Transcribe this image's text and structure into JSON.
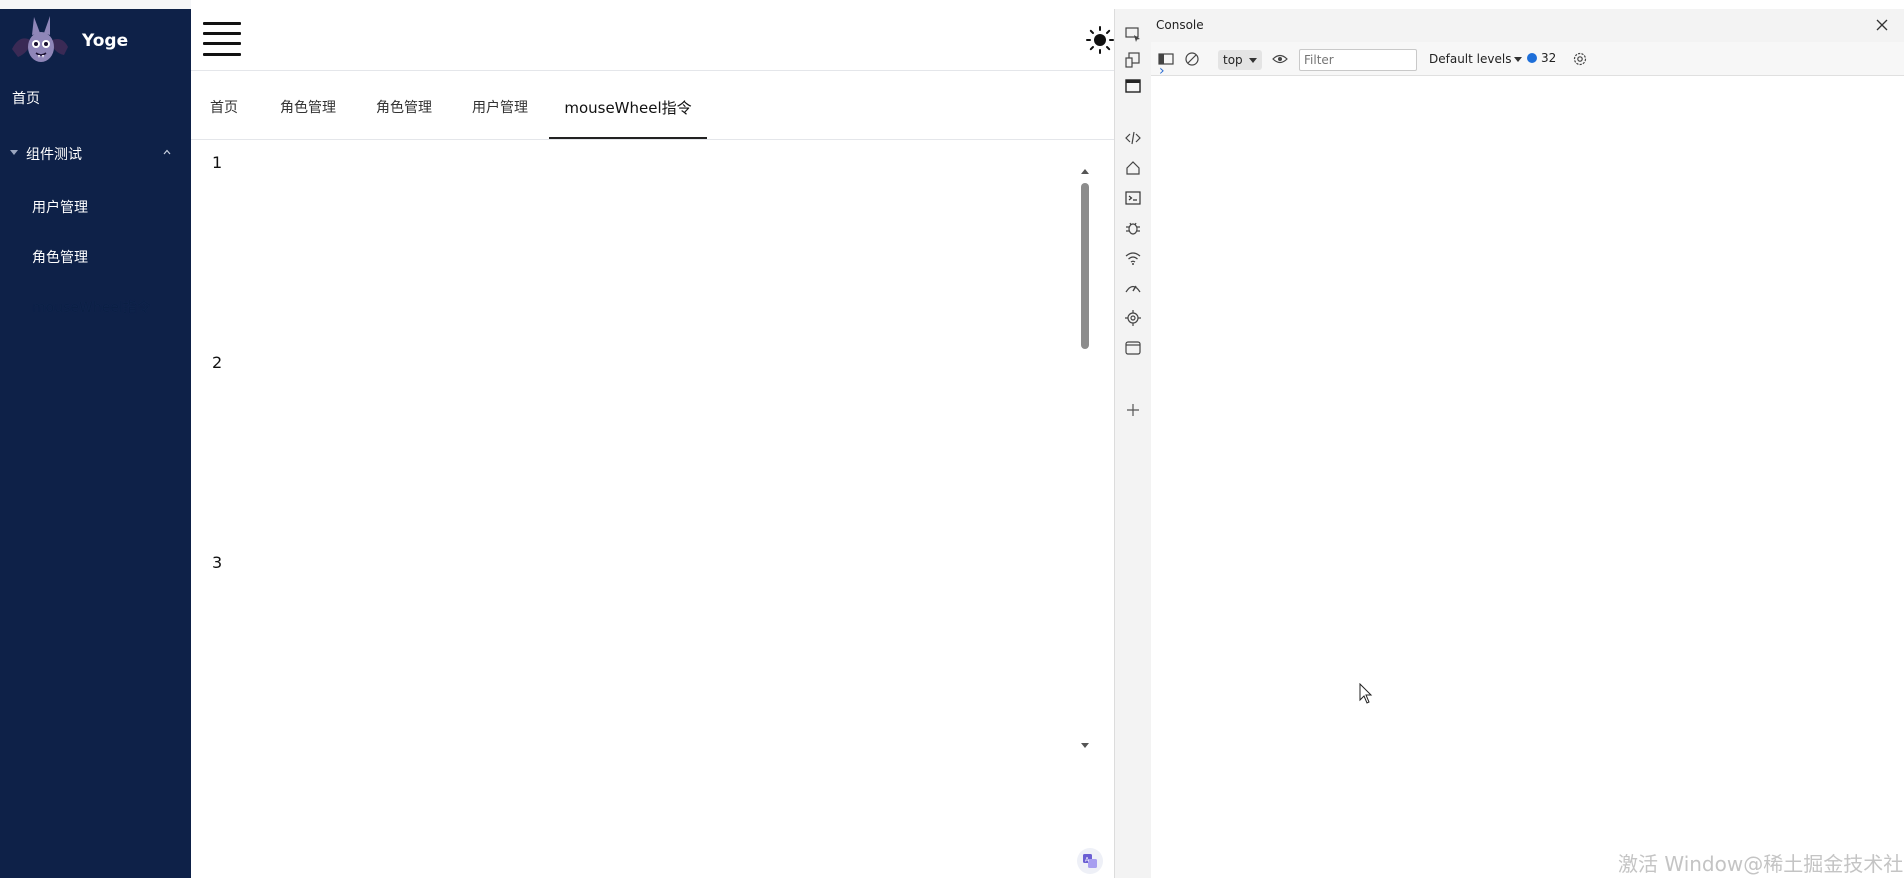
{
  "sidebar": {
    "brand": "Yoge",
    "items": [
      {
        "label": "首页"
      },
      {
        "label": "组件测试"
      }
    ],
    "subitems": [
      {
        "label": "用户管理"
      },
      {
        "label": "角色管理"
      },
      {
        "label": "mouseWheel指令"
      }
    ],
    "bg_color": "#0e2148"
  },
  "tabs": [
    {
      "label": "首页"
    },
    {
      "label": "角色管理"
    },
    {
      "label": "角色管理"
    },
    {
      "label": "用户管理"
    },
    {
      "label": "mouseWheel指令"
    }
  ],
  "content": {
    "numbers": [
      "1",
      "2",
      "3"
    ]
  },
  "devtools": {
    "title": "Console",
    "context": "top",
    "filter_placeholder": "Filter",
    "levels": "Default levels",
    "message_count": "32",
    "prompt": "›"
  },
  "watermark": "激活 Window@稀土掘金技术社区"
}
